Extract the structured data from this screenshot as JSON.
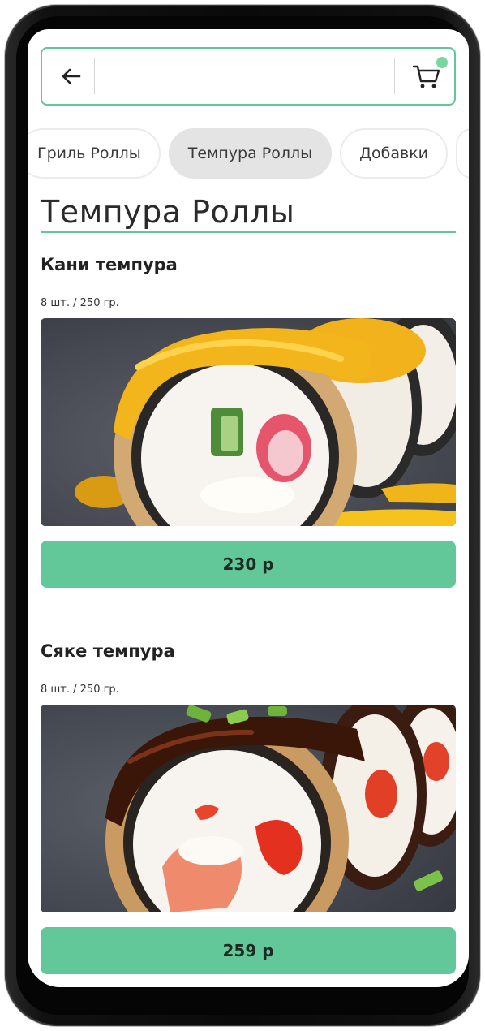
{
  "header": {
    "search_value": "",
    "search_placeholder": ""
  },
  "categories": [
    {
      "label": "Гриль Роллы",
      "active": false
    },
    {
      "label": "Темпура Роллы",
      "active": true
    },
    {
      "label": "Добавки",
      "active": false
    }
  ],
  "section": {
    "title": "Темпура Роллы"
  },
  "products": [
    {
      "name": "Кани темпура",
      "meta": "8 шт. / 250 гр.",
      "price": "230 р",
      "image_icon": "kani-tempura-roll-photo"
    },
    {
      "name": "Сяке темпура",
      "meta": "8 шт. / 250 гр.",
      "price": "259 р",
      "image_icon": "syake-tempura-roll-photo"
    }
  ],
  "colors": {
    "accent": "#62c89a",
    "price_button": "#63c899",
    "cart_badge": "#78d79f",
    "chip_active": "#e4e4e4"
  }
}
